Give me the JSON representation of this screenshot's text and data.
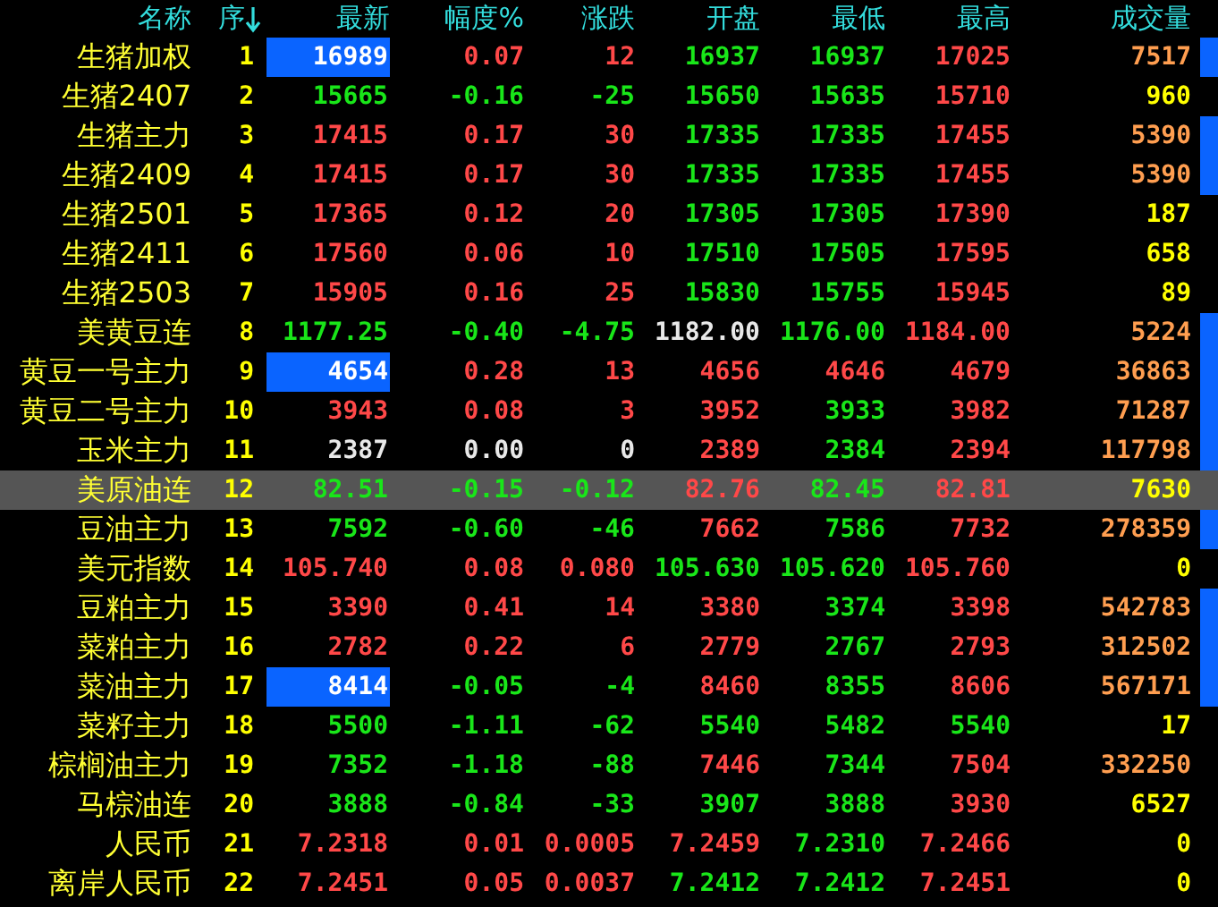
{
  "header": {
    "columns": [
      {
        "label": "名称",
        "sorted": false
      },
      {
        "label": "序",
        "sorted": true
      },
      {
        "label": "最新",
        "sorted": false
      },
      {
        "label": "幅度%",
        "sorted": false
      },
      {
        "label": "涨跌",
        "sorted": false
      },
      {
        "label": "开盘",
        "sorted": false
      },
      {
        "label": "最低",
        "sorted": false
      },
      {
        "label": "最高",
        "sorted": false
      },
      {
        "label": "成交量",
        "sorted": false
      }
    ]
  },
  "rows": [
    {
      "name": "生猪加权",
      "seq": "1",
      "flash": true,
      "marked": true,
      "selected": false,
      "cells": [
        {
          "text": "16989"
        },
        {
          "text": "0.07",
          "color": "#ff4848"
        },
        {
          "text": "12",
          "color": "#ff4848"
        },
        {
          "text": "16937",
          "color": "#19e619"
        },
        {
          "text": "16937",
          "color": "#19e619"
        },
        {
          "text": "17025",
          "color": "#ff4848"
        }
      ],
      "volume": {
        "text": "7517",
        "color": "#ff9e50"
      }
    },
    {
      "name": "生猪2407",
      "seq": "2",
      "flash": false,
      "marked": false,
      "selected": false,
      "cells": [
        {
          "text": "15665",
          "color": "#19e619"
        },
        {
          "text": "-0.16",
          "color": "#19e619"
        },
        {
          "text": "-25",
          "color": "#19e619"
        },
        {
          "text": "15650",
          "color": "#19e619"
        },
        {
          "text": "15635",
          "color": "#19e619"
        },
        {
          "text": "15710",
          "color": "#ff4848"
        }
      ],
      "volume": {
        "text": "960",
        "color": "#ffff00"
      }
    },
    {
      "name": "生猪主力",
      "seq": "3",
      "flash": false,
      "marked": true,
      "selected": false,
      "cells": [
        {
          "text": "17415",
          "color": "#ff4848"
        },
        {
          "text": "0.17",
          "color": "#ff4848"
        },
        {
          "text": "30",
          "color": "#ff4848"
        },
        {
          "text": "17335",
          "color": "#19e619"
        },
        {
          "text": "17335",
          "color": "#19e619"
        },
        {
          "text": "17455",
          "color": "#ff4848"
        }
      ],
      "volume": {
        "text": "5390",
        "color": "#ff9e50"
      }
    },
    {
      "name": "生猪2409",
      "seq": "4",
      "flash": false,
      "marked": true,
      "selected": false,
      "cells": [
        {
          "text": "17415",
          "color": "#ff4848"
        },
        {
          "text": "0.17",
          "color": "#ff4848"
        },
        {
          "text": "30",
          "color": "#ff4848"
        },
        {
          "text": "17335",
          "color": "#19e619"
        },
        {
          "text": "17335",
          "color": "#19e619"
        },
        {
          "text": "17455",
          "color": "#ff4848"
        }
      ],
      "volume": {
        "text": "5390",
        "color": "#ff9e50"
      }
    },
    {
      "name": "生猪2501",
      "seq": "5",
      "flash": false,
      "marked": false,
      "selected": false,
      "cells": [
        {
          "text": "17365",
          "color": "#ff4848"
        },
        {
          "text": "0.12",
          "color": "#ff4848"
        },
        {
          "text": "20",
          "color": "#ff4848"
        },
        {
          "text": "17305",
          "color": "#19e619"
        },
        {
          "text": "17305",
          "color": "#19e619"
        },
        {
          "text": "17390",
          "color": "#ff4848"
        }
      ],
      "volume": {
        "text": "187",
        "color": "#ffff00"
      }
    },
    {
      "name": "生猪2411",
      "seq": "6",
      "flash": false,
      "marked": false,
      "selected": false,
      "cells": [
        {
          "text": "17560",
          "color": "#ff4848"
        },
        {
          "text": "0.06",
          "color": "#ff4848"
        },
        {
          "text": "10",
          "color": "#ff4848"
        },
        {
          "text": "17510",
          "color": "#19e619"
        },
        {
          "text": "17505",
          "color": "#19e619"
        },
        {
          "text": "17595",
          "color": "#ff4848"
        }
      ],
      "volume": {
        "text": "658",
        "color": "#ffff00"
      }
    },
    {
      "name": "生猪2503",
      "seq": "7",
      "flash": false,
      "marked": false,
      "selected": false,
      "cells": [
        {
          "text": "15905",
          "color": "#ff4848"
        },
        {
          "text": "0.16",
          "color": "#ff4848"
        },
        {
          "text": "25",
          "color": "#ff4848"
        },
        {
          "text": "15830",
          "color": "#19e619"
        },
        {
          "text": "15755",
          "color": "#19e619"
        },
        {
          "text": "15945",
          "color": "#ff4848"
        }
      ],
      "volume": {
        "text": "89",
        "color": "#ffff00"
      }
    },
    {
      "name": "美黄豆连",
      "seq": "8",
      "flash": false,
      "marked": true,
      "selected": false,
      "cells": [
        {
          "text": "1177.25",
          "color": "#19e619"
        },
        {
          "text": "-0.40",
          "color": "#19e619"
        },
        {
          "text": "-4.75",
          "color": "#19e619"
        },
        {
          "text": "1182.00",
          "color": "#e8e8e8"
        },
        {
          "text": "1176.00",
          "color": "#19e619"
        },
        {
          "text": "1184.00",
          "color": "#ff4848"
        }
      ],
      "volume": {
        "text": "5224",
        "color": "#ff9e50"
      }
    },
    {
      "name": "黄豆一号主力",
      "seq": "9",
      "flash": true,
      "marked": true,
      "selected": false,
      "cells": [
        {
          "text": "4654"
        },
        {
          "text": "0.28",
          "color": "#ff4848"
        },
        {
          "text": "13",
          "color": "#ff4848"
        },
        {
          "text": "4656",
          "color": "#ff4848"
        },
        {
          "text": "4646",
          "color": "#ff4848"
        },
        {
          "text": "4679",
          "color": "#ff4848"
        }
      ],
      "volume": {
        "text": "36863",
        "color": "#ff9e50"
      }
    },
    {
      "name": "黄豆二号主力",
      "seq": "10",
      "flash": false,
      "marked": true,
      "selected": false,
      "cells": [
        {
          "text": "3943",
          "color": "#ff4848"
        },
        {
          "text": "0.08",
          "color": "#ff4848"
        },
        {
          "text": "3",
          "color": "#ff4848"
        },
        {
          "text": "3952",
          "color": "#ff4848"
        },
        {
          "text": "3933",
          "color": "#19e619"
        },
        {
          "text": "3982",
          "color": "#ff4848"
        }
      ],
      "volume": {
        "text": "71287",
        "color": "#ff9e50"
      }
    },
    {
      "name": "玉米主力",
      "seq": "11",
      "flash": false,
      "marked": true,
      "selected": false,
      "cells": [
        {
          "text": "2387",
          "color": "#e8e8e8"
        },
        {
          "text": "0.00",
          "color": "#e8e8e8"
        },
        {
          "text": "0",
          "color": "#e8e8e8"
        },
        {
          "text": "2389",
          "color": "#ff4848"
        },
        {
          "text": "2384",
          "color": "#19e619"
        },
        {
          "text": "2394",
          "color": "#ff4848"
        }
      ],
      "volume": {
        "text": "117798",
        "color": "#ff9e50"
      }
    },
    {
      "name": "美原油连",
      "seq": "12",
      "flash": false,
      "marked": false,
      "selected": true,
      "cells": [
        {
          "text": "82.51",
          "color": "#19e619"
        },
        {
          "text": "-0.15",
          "color": "#19e619"
        },
        {
          "text": "-0.12",
          "color": "#19e619"
        },
        {
          "text": "82.76",
          "color": "#ff4848"
        },
        {
          "text": "82.45",
          "color": "#19e619"
        },
        {
          "text": "82.81",
          "color": "#ff4848"
        }
      ],
      "volume": {
        "text": "7630",
        "color": "#ffff00"
      }
    },
    {
      "name": "豆油主力",
      "seq": "13",
      "flash": false,
      "marked": true,
      "selected": false,
      "cells": [
        {
          "text": "7592",
          "color": "#19e619"
        },
        {
          "text": "-0.60",
          "color": "#19e619"
        },
        {
          "text": "-46",
          "color": "#19e619"
        },
        {
          "text": "7662",
          "color": "#ff4848"
        },
        {
          "text": "7586",
          "color": "#19e619"
        },
        {
          "text": "7732",
          "color": "#ff4848"
        }
      ],
      "volume": {
        "text": "278359",
        "color": "#ff9e50"
      }
    },
    {
      "name": "美元指数",
      "seq": "14",
      "flash": false,
      "marked": false,
      "selected": false,
      "cells": [
        {
          "text": "105.740",
          "color": "#ff4848"
        },
        {
          "text": "0.08",
          "color": "#ff4848"
        },
        {
          "text": "0.080",
          "color": "#ff4848"
        },
        {
          "text": "105.630",
          "color": "#19e619"
        },
        {
          "text": "105.620",
          "color": "#19e619"
        },
        {
          "text": "105.760",
          "color": "#ff4848"
        }
      ],
      "volume": {
        "text": "0",
        "color": "#ffff00"
      }
    },
    {
      "name": "豆粕主力",
      "seq": "15",
      "flash": false,
      "marked": true,
      "selected": false,
      "cells": [
        {
          "text": "3390",
          "color": "#ff4848"
        },
        {
          "text": "0.41",
          "color": "#ff4848"
        },
        {
          "text": "14",
          "color": "#ff4848"
        },
        {
          "text": "3380",
          "color": "#ff4848"
        },
        {
          "text": "3374",
          "color": "#19e619"
        },
        {
          "text": "3398",
          "color": "#ff4848"
        }
      ],
      "volume": {
        "text": "542783",
        "color": "#ff9e50"
      }
    },
    {
      "name": "菜粕主力",
      "seq": "16",
      "flash": false,
      "marked": true,
      "selected": false,
      "cells": [
        {
          "text": "2782",
          "color": "#ff4848"
        },
        {
          "text": "0.22",
          "color": "#ff4848"
        },
        {
          "text": "6",
          "color": "#ff4848"
        },
        {
          "text": "2779",
          "color": "#ff4848"
        },
        {
          "text": "2767",
          "color": "#19e619"
        },
        {
          "text": "2793",
          "color": "#ff4848"
        }
      ],
      "volume": {
        "text": "312502",
        "color": "#ff9e50"
      }
    },
    {
      "name": "菜油主力",
      "seq": "17",
      "flash": true,
      "marked": true,
      "selected": false,
      "cells": [
        {
          "text": "8414"
        },
        {
          "text": "-0.05",
          "color": "#19e619"
        },
        {
          "text": "-4",
          "color": "#19e619"
        },
        {
          "text": "8460",
          "color": "#ff4848"
        },
        {
          "text": "8355",
          "color": "#19e619"
        },
        {
          "text": "8606",
          "color": "#ff4848"
        }
      ],
      "volume": {
        "text": "567171",
        "color": "#ff9e50"
      }
    },
    {
      "name": "菜籽主力",
      "seq": "18",
      "flash": false,
      "marked": false,
      "selected": false,
      "cells": [
        {
          "text": "5500",
          "color": "#19e619"
        },
        {
          "text": "-1.11",
          "color": "#19e619"
        },
        {
          "text": "-62",
          "color": "#19e619"
        },
        {
          "text": "5540",
          "color": "#19e619"
        },
        {
          "text": "5482",
          "color": "#19e619"
        },
        {
          "text": "5540",
          "color": "#19e619"
        }
      ],
      "volume": {
        "text": "17",
        "color": "#ffff00"
      }
    },
    {
      "name": "棕榈油主力",
      "seq": "19",
      "flash": false,
      "marked": false,
      "selected": false,
      "cells": [
        {
          "text": "7352",
          "color": "#19e619"
        },
        {
          "text": "-1.18",
          "color": "#19e619"
        },
        {
          "text": "-88",
          "color": "#19e619"
        },
        {
          "text": "7446",
          "color": "#ff4848"
        },
        {
          "text": "7344",
          "color": "#19e619"
        },
        {
          "text": "7504",
          "color": "#ff4848"
        }
      ],
      "volume": {
        "text": "332250",
        "color": "#ff9e50"
      }
    },
    {
      "name": "马棕油连",
      "seq": "20",
      "flash": false,
      "marked": false,
      "selected": false,
      "cells": [
        {
          "text": "3888",
          "color": "#19e619"
        },
        {
          "text": "-0.84",
          "color": "#19e619"
        },
        {
          "text": "-33",
          "color": "#19e619"
        },
        {
          "text": "3907",
          "color": "#19e619"
        },
        {
          "text": "3888",
          "color": "#19e619"
        },
        {
          "text": "3930",
          "color": "#ff4848"
        }
      ],
      "volume": {
        "text": "6527",
        "color": "#ffff00"
      }
    },
    {
      "name": "人民币",
      "seq": "21",
      "flash": false,
      "marked": false,
      "selected": false,
      "cells": [
        {
          "text": "7.2318",
          "color": "#ff4848"
        },
        {
          "text": "0.01",
          "color": "#ff4848"
        },
        {
          "text": "0.0005",
          "color": "#ff4848"
        },
        {
          "text": "7.2459",
          "color": "#ff4848"
        },
        {
          "text": "7.2310",
          "color": "#19e619"
        },
        {
          "text": "7.2466",
          "color": "#ff4848"
        }
      ],
      "volume": {
        "text": "0",
        "color": "#ffff00"
      }
    },
    {
      "name": "离岸人民币",
      "seq": "22",
      "flash": false,
      "marked": false,
      "selected": false,
      "cells": [
        {
          "text": "7.2451",
          "color": "#ff4848"
        },
        {
          "text": "0.05",
          "color": "#ff4848"
        },
        {
          "text": "0.0037",
          "color": "#ff4848"
        },
        {
          "text": "7.2412",
          "color": "#19e619"
        },
        {
          "text": "7.2412",
          "color": "#19e619"
        },
        {
          "text": "7.2451",
          "color": "#ff4848"
        }
      ],
      "volume": {
        "text": "0",
        "color": "#ffff00"
      }
    }
  ]
}
